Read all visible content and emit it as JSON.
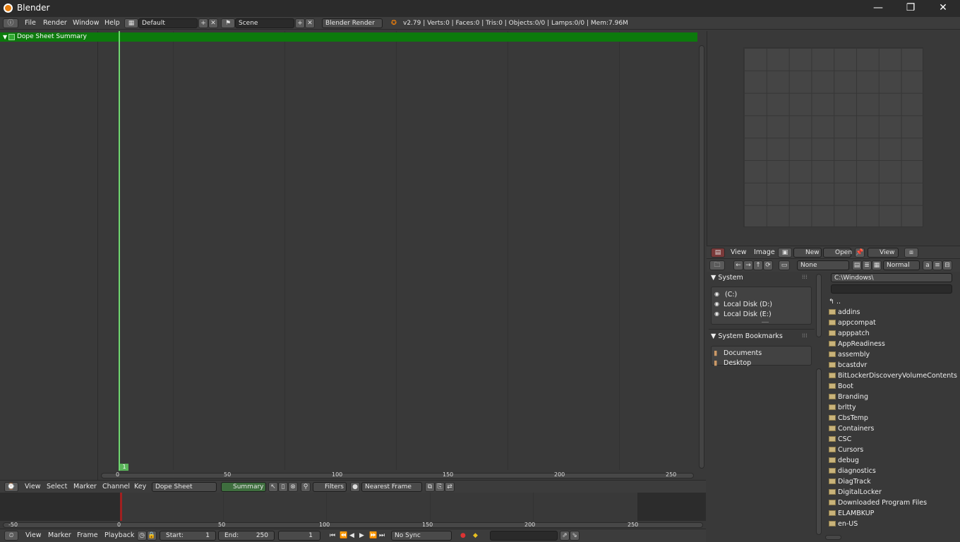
{
  "window": {
    "title": "Blender",
    "minimize": "—",
    "maximize": "❐",
    "close": "✕"
  },
  "info": {
    "menus": [
      "File",
      "Render",
      "Window",
      "Help"
    ],
    "screen_layout": "Default",
    "scene": "Scene",
    "engine": "Blender Render",
    "stats": "v2.79 | Verts:0 | Faces:0 | Tris:0 | Objects:0/0 | Lamps:0/0 | Mem:7.96M"
  },
  "dopesheet": {
    "summary_label": "Dope Sheet Summary",
    "current_frame_badge": "1",
    "ruler_ticks": [
      "0",
      "50",
      "100",
      "150",
      "200",
      "250"
    ],
    "header_menus": [
      "View",
      "Select",
      "Marker",
      "Channel",
      "Key"
    ],
    "mode": "Dope Sheet",
    "summary_toggle": "Summary",
    "filters": "Filters",
    "snapping": "Nearest Frame"
  },
  "timeline": {
    "ruler_ticks": [
      "-50",
      "0",
      "50",
      "100",
      "150",
      "200",
      "250"
    ],
    "header_menus": [
      "View",
      "Marker",
      "Frame",
      "Playback"
    ],
    "start_label": "Start:",
    "start_value": "1",
    "end_label": "End:",
    "end_value": "250",
    "current_frame": "1",
    "sync": "No Sync"
  },
  "image_editor": {
    "menus": [
      "View",
      "Image"
    ],
    "new_button": "New",
    "open_button": "Open",
    "view_dropdown": "View"
  },
  "file_browser": {
    "filter_none": "None",
    "display_mode": "Normal",
    "path": "C:\\Windows\\",
    "filename": "",
    "system_panel": "System",
    "drives": [
      "(C:)",
      "Local Disk (D:)",
      "Local Disk (E:)"
    ],
    "bookmarks_panel": "System Bookmarks",
    "bookmarks": [
      "Documents",
      "Desktop"
    ],
    "parent": "..",
    "folders": [
      "addins",
      "appcompat",
      "apppatch",
      "AppReadiness",
      "assembly",
      "bcastdvr",
      "BitLockerDiscoveryVolumeContents",
      "Boot",
      "Branding",
      "brltty",
      "CbsTemp",
      "Containers",
      "CSC",
      "Cursors",
      "debug",
      "diagnostics",
      "DiagTrack",
      "DigitalLocker",
      "Downloaded Program Files",
      "ELAMBKUP",
      "en-US"
    ]
  },
  "colors": {
    "summary_green": "#0c7a0c",
    "frame_cursor": "#6fd56f",
    "timeline_cursor": "#a02020"
  }
}
